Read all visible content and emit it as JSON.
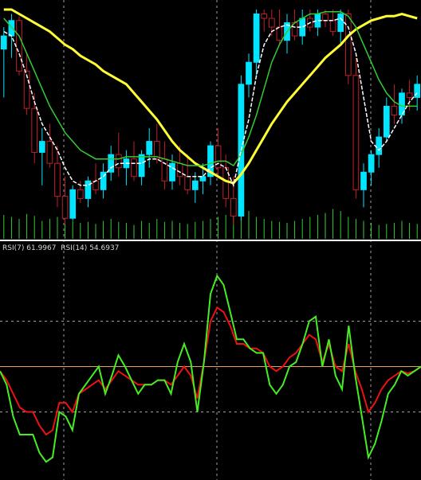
{
  "rsi_label": {
    "rsi7_name": "RSI(7)",
    "rsi7_value": "61.9967",
    "rsi14_name": "RSI(14)",
    "rsi14_value": "54.6937"
  },
  "colors": {
    "background": "#000000",
    "bull_candle": "#00e5ff",
    "bear_candle": "#c0202a",
    "ma_fast": "#ffffff",
    "ma_mid": "#33cc33",
    "ma_slow": "#ffff33",
    "volume": "#33cc33",
    "rsi7": "#44ee22",
    "rsi14": "#ee1111",
    "rsi_midline": "#e8a060",
    "grid": "#c8c8c8",
    "separator": "#ffffff"
  },
  "chart_data": [
    {
      "type": "candlestick",
      "panel": "price",
      "ylim": [
        0,
        100
      ],
      "candles": [
        [
          82,
          92,
          60,
          88
        ],
        [
          88,
          98,
          78,
          95
        ],
        [
          95,
          97,
          70,
          72
        ],
        [
          72,
          80,
          52,
          55
        ],
        [
          55,
          62,
          30,
          35
        ],
        [
          35,
          46,
          20,
          40
        ],
        [
          40,
          48,
          28,
          30
        ],
        [
          30,
          38,
          10,
          15
        ],
        [
          15,
          24,
          2,
          5
        ],
        [
          5,
          20,
          4,
          18
        ],
        [
          18,
          22,
          12,
          14
        ],
        [
          14,
          24,
          10,
          22
        ],
        [
          22,
          30,
          16,
          18
        ],
        [
          18,
          30,
          14,
          26
        ],
        [
          26,
          38,
          22,
          34
        ],
        [
          34,
          44,
          24,
          28
        ],
        [
          28,
          36,
          20,
          32
        ],
        [
          32,
          40,
          22,
          24
        ],
        [
          24,
          36,
          20,
          34
        ],
        [
          34,
          46,
          28,
          40
        ],
        [
          40,
          48,
          30,
          32
        ],
        [
          32,
          40,
          18,
          22
        ],
        [
          22,
          34,
          18,
          30
        ],
        [
          30,
          38,
          20,
          24
        ],
        [
          24,
          34,
          16,
          18
        ],
        [
          18,
          26,
          12,
          22
        ],
        [
          22,
          30,
          16,
          24
        ],
        [
          24,
          40,
          20,
          38
        ],
        [
          38,
          46,
          24,
          28
        ],
        [
          28,
          34,
          10,
          14
        ],
        [
          14,
          24,
          2,
          6
        ],
        [
          6,
          70,
          4,
          66
        ],
        [
          66,
          80,
          60,
          76
        ],
        [
          76,
          100,
          70,
          98
        ],
        [
          98,
          100,
          90,
          96
        ],
        [
          96,
          100,
          88,
          92
        ],
        [
          92,
          100,
          84,
          86
        ],
        [
          86,
          98,
          80,
          94
        ],
        [
          94,
          100,
          86,
          88
        ],
        [
          88,
          100,
          84,
          96
        ],
        [
          96,
          100,
          90,
          92
        ],
        [
          92,
          100,
          88,
          98
        ],
        [
          98,
          100,
          92,
          95
        ],
        [
          95,
          100,
          88,
          90
        ],
        [
          90,
          100,
          84,
          98
        ],
        [
          98,
          100,
          66,
          70
        ],
        [
          70,
          78,
          14,
          18
        ],
        [
          18,
          30,
          10,
          26
        ],
        [
          26,
          36,
          20,
          34
        ],
        [
          34,
          46,
          28,
          42
        ],
        [
          42,
          60,
          40,
          56
        ],
        [
          56,
          66,
          48,
          52
        ],
        [
          52,
          64,
          48,
          62
        ],
        [
          62,
          68,
          54,
          60
        ],
        [
          60,
          70,
          54,
          66
        ]
      ],
      "volume": [
        24,
        22,
        20,
        25,
        23,
        18,
        20,
        22,
        15,
        18,
        16,
        17,
        15,
        18,
        20,
        17,
        16,
        14,
        18,
        16,
        20,
        17,
        18,
        16,
        15,
        17,
        18,
        20,
        22,
        24,
        26,
        30,
        28,
        22,
        20,
        18,
        17,
        16,
        18,
        20,
        22,
        24,
        26,
        30,
        28,
        22,
        20,
        18,
        16,
        14,
        15,
        16,
        18,
        16,
        15
      ],
      "ma_fast": [
        90,
        88,
        80,
        70,
        58,
        48,
        42,
        36,
        28,
        22,
        20,
        20,
        22,
        24,
        28,
        30,
        30,
        30,
        30,
        32,
        32,
        30,
        28,
        26,
        24,
        24,
        24,
        28,
        30,
        28,
        20,
        36,
        50,
        70,
        84,
        90,
        92,
        93,
        92,
        92,
        94,
        95,
        95,
        95,
        96,
        92,
        80,
        60,
        40,
        36,
        40,
        46,
        52,
        58,
        62
      ],
      "ma_mid": [
        96,
        92,
        88,
        80,
        72,
        64,
        56,
        50,
        44,
        40,
        36,
        34,
        32,
        32,
        32,
        32,
        33,
        33,
        33,
        33,
        33,
        32,
        31,
        30,
        29,
        29,
        29,
        30,
        31,
        31,
        29,
        34,
        42,
        52,
        64,
        76,
        84,
        90,
        94,
        96,
        98,
        98,
        99,
        99,
        99,
        97,
        92,
        84,
        76,
        68,
        62,
        58,
        56,
        56,
        56
      ],
      "ma_slow": [
        100,
        100,
        98,
        96,
        94,
        92,
        90,
        87,
        84,
        82,
        79,
        77,
        75,
        72,
        70,
        68,
        66,
        62,
        58,
        54,
        50,
        45,
        40,
        36,
        33,
        30,
        28,
        26,
        24,
        22,
        21,
        25,
        30,
        36,
        42,
        48,
        53,
        58,
        62,
        66,
        70,
        74,
        78,
        81,
        84,
        88,
        91,
        93,
        95,
        96,
        97,
        97,
        98,
        97,
        96
      ]
    },
    {
      "type": "line",
      "panel": "rsi",
      "ylim": [
        0,
        100
      ],
      "midline": 50,
      "series": [
        {
          "name": "RSI(7)",
          "values": [
            48,
            42,
            28,
            20,
            20,
            20,
            12,
            8,
            10,
            30,
            28,
            22,
            38,
            42,
            46,
            50,
            38,
            46,
            55,
            50,
            44,
            38,
            42,
            42,
            44,
            44,
            38,
            52,
            60,
            52,
            30,
            52,
            82,
            90,
            86,
            74,
            62,
            62,
            58,
            56,
            56,
            42,
            38,
            42,
            50,
            52,
            60,
            70,
            72,
            50,
            62,
            46,
            40,
            68,
            46,
            28,
            10,
            16,
            26,
            38,
            42,
            48,
            46,
            48,
            50
          ]
        },
        {
          "name": "RSI(14)",
          "values": [
            48,
            44,
            38,
            32,
            30,
            30,
            24,
            20,
            22,
            34,
            34,
            30,
            38,
            40,
            42,
            44,
            40,
            44,
            48,
            46,
            44,
            42,
            42,
            42,
            44,
            44,
            42,
            46,
            50,
            46,
            36,
            52,
            70,
            76,
            74,
            68,
            60,
            60,
            58,
            58,
            56,
            50,
            48,
            50,
            54,
            56,
            60,
            64,
            62,
            52,
            60,
            50,
            48,
            60,
            48,
            40,
            30,
            34,
            40,
            44,
            46,
            48,
            47,
            48,
            50
          ]
        }
      ]
    }
  ]
}
